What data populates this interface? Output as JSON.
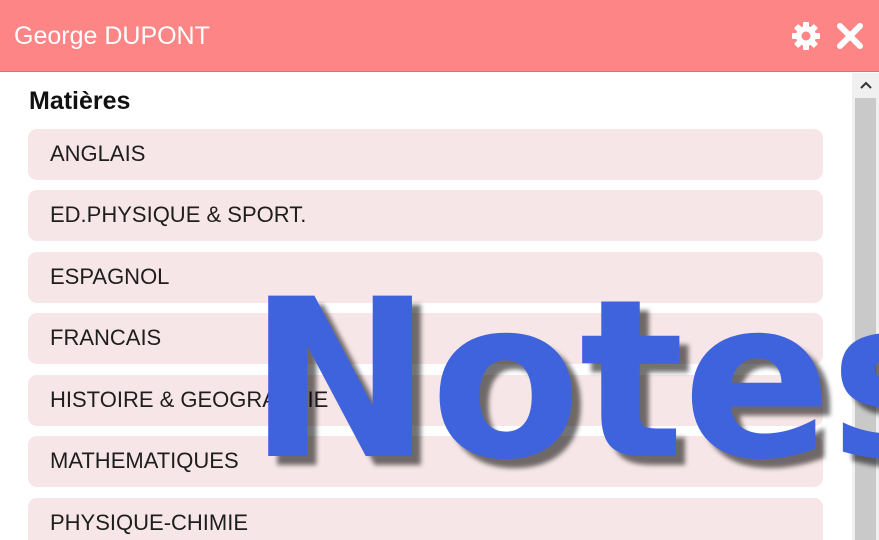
{
  "window": {
    "title": "George DUPONT",
    "accent_color": "#fd8585",
    "settings_icon": "gear-icon",
    "close_icon": "close-icon"
  },
  "section": {
    "title": "Matières"
  },
  "subjects": [
    {
      "label": "ANGLAIS"
    },
    {
      "label": "ED.PHYSIQUE & SPORT."
    },
    {
      "label": "ESPAGNOL"
    },
    {
      "label": "FRANCAIS"
    },
    {
      "label": "HISTOIRE & GEOGRAPHIE"
    },
    {
      "label": "MATHEMATIQUES"
    },
    {
      "label": "PHYSIQUE-CHIMIE"
    }
  ],
  "overlay": {
    "text": "Notes",
    "color": "#3e63dd"
  },
  "scrollbar": {
    "up_icon": "chevron-up-icon"
  }
}
